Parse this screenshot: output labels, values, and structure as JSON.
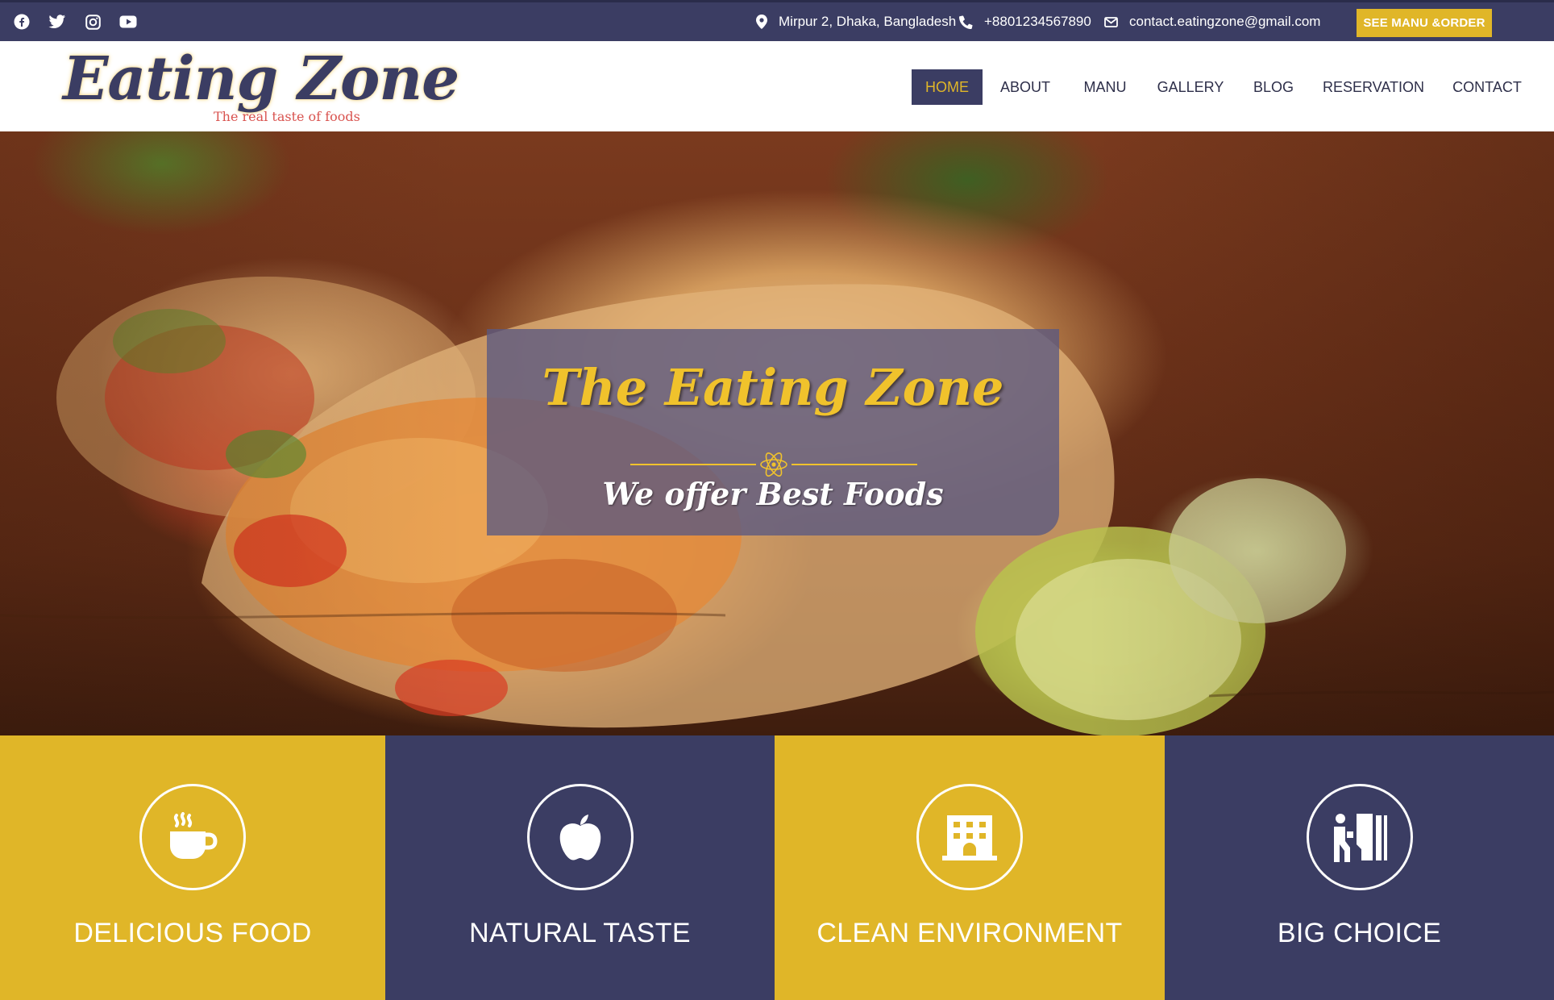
{
  "topbar": {
    "social": [
      "facebook-icon",
      "twitter-icon",
      "instagram-icon",
      "youtube-icon"
    ],
    "address": "Mirpur 2, Dhaka, Bangladesh",
    "phone": "+8801234567890",
    "email": "contact.eatingzone@gmail.com",
    "order_button": "SEE MANU &ORDER"
  },
  "logo": {
    "title": "Eating Zone",
    "tagline": "The real taste of foods"
  },
  "nav": {
    "items": [
      "HOME",
      "ABOUT",
      "MANU",
      "GALLERY",
      "BLOG",
      "RESERVATION",
      "CONTACT"
    ],
    "active": "HOME"
  },
  "hero": {
    "title": "The Eating Zone",
    "subtitle": "We offer Best Foods",
    "divider_icon": "atom-icon"
  },
  "features": [
    {
      "label": "DELICIOUS FOOD",
      "icon": "coffee-cup-icon"
    },
    {
      "label": "NATURAL TASTE",
      "icon": "apple-icon"
    },
    {
      "label": "CLEAN ENVIRONMENT",
      "icon": "building-icon"
    },
    {
      "label": "BIG CHOICE",
      "icon": "restroom-icon"
    }
  ],
  "colors": {
    "navy": "#3b3d63",
    "gold": "#e0b628",
    "white": "#ffffff"
  }
}
